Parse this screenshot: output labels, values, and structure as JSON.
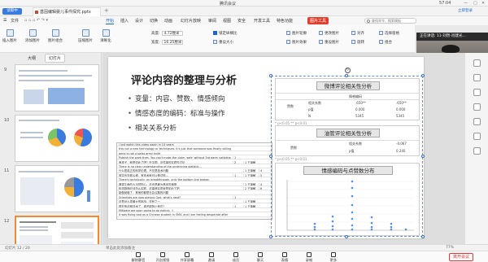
{
  "meeting": {
    "title": "腾讯会议",
    "clock": "57:04",
    "recording_badge": "读取中",
    "leave_label": "离开会议",
    "toolbar": [
      {
        "label": "解除静音",
        "icon": "mic-off-icon"
      },
      {
        "label": "开启视频",
        "icon": "camera-off-icon"
      },
      {
        "label": "共享屏幕",
        "icon": "share-screen-icon"
      },
      {
        "label": "邀请",
        "icon": "invite-icon"
      },
      {
        "label": "成员",
        "icon": "members-icon"
      },
      {
        "label": "聊天",
        "icon": "chat-icon"
      },
      {
        "label": "表情",
        "icon": "emoji-icon"
      },
      {
        "label": "录制",
        "icon": "record-icon"
      },
      {
        "label": "更多",
        "icon": "more-icon"
      }
    ],
    "speaker_label": "正在讲话: 11-刘然-肖建光...",
    "speaker_name": "11-刘然-肖建..."
  },
  "wps": {
    "doc_tab": "基因编辑婴儿事件探究.pptx",
    "sign_label": "立即登录",
    "menus": [
      "文件",
      "开始",
      "插入",
      "设计",
      "切换",
      "动画",
      "幻灯片放映",
      "审阅",
      "视图",
      "安全",
      "开发工具",
      "特色功能"
    ],
    "active_menu": "图片工具",
    "search_placeholder": "查找命令、搜索模板",
    "toolbar": {
      "big_buttons": [
        "插入图片",
        "添加图片",
        "图片组合",
        "压缩图片",
        "清晰化"
      ],
      "height_label": "高度:",
      "height_value": "4.72厘米",
      "width_label": "宽度:",
      "width_value": "16.25厘米",
      "lock_ratio": "锁定纵横比",
      "reset_size": "重设大小",
      "right_items": [
        "图片轮廓",
        "图片效果",
        "更改图片",
        "重设图片",
        "对齐",
        "旋转",
        "选择窗格",
        "组合"
      ]
    }
  },
  "left_panel": {
    "tab_outline": "大纲",
    "tab_slides": "幻灯片",
    "slide_numbers": [
      "9",
      "10",
      "11",
      "12"
    ]
  },
  "slide": {
    "title": "评论内容的整理与分析",
    "bullets": [
      "变量：内容、赞数、情感倾向",
      "情感态度的编码：标准与操作",
      "相关关系分析"
    ],
    "panel1": {
      "title": "微博评论相关性分析",
      "row_labels": [
        "",
        "赞数",
        ""
      ],
      "col_labels": [
        "",
        "情感编码"
      ],
      "cells": [
        "相关系数",
        ".650**",
        "p值",
        "0.000",
        "N",
        "5345"
      ],
      "note": "* p<0.05  ** p<0.01"
    },
    "panel2": {
      "title": "油管评论相关性分析",
      "cells": [
        "相关系数",
        "-0.067",
        "赞数",
        "p值",
        "0.240"
      ],
      "note": "* p<0.05  ** p<0.01"
    },
    "panel3": {
      "title": "情感编码与点赞数分布"
    },
    "table_note": "* p<0.05  ** p<0.01",
    "table_rows": [
      [
        "i just watch this video again in 10 years",
        "",
        "",
        ""
      ],
      [
        "this not a new technology or techniques. it's just that someone was finally willing to do it",
        "",
        "",
        ""
      ],
      [
        "gene is not a swiss army knife",
        "",
        "",
        ""
      ],
      [
        "Publish the work then. You can't make the claim 'safe' without 3rd party validation.",
        "1",
        "",
        ""
      ],
      [
        "养孩子，就是如此了吧？在中国，这件事的实质性讨论",
        "2",
        "1 王菊敏",
        ""
      ],
      [
        "There is no clear understanding of the underlying statistic...",
        "",
        "",
        ""
      ],
      [
        "什么是真正的科学伦理，不仅是技术问题",
        "",
        "1 王菊敏",
        "4"
      ],
      [
        "其实也没那么难：有技术就可以做试验…",
        "1",
        "1 王菊敏",
        "5"
      ],
      [
        "There's technically, on breakthrough, only the bottom line broken",
        "",
        "",
        ""
      ],
      [
        "尊重生命的人当然担心，这也是最为基本的道德",
        "",
        "1 王菊敏",
        "4"
      ],
      [
        "科学精神应该怎么实践，这事情实质就是如此了吧",
        "",
        "2 王菊敏",
        "6"
      ],
      [
        "能做就做了，其他的都是社会议题的问题",
        "",
        "",
        ""
      ],
      [
        "Scientists are now playing God, what's next?",
        "1",
        "",
        ""
      ],
      [
        "这是对人类最大的挑战，没有之一",
        "",
        "1 王菊敏",
        ""
      ],
      [
        "现在有这种技术了，谁还能阻止他们？",
        "1",
        "1 王菊敏",
        ""
      ],
      [
        "Mitigate are soon going to go extinct. ;)",
        "",
        "",
        ""
      ],
      [
        "it was fixing bad as a Chinese student in SMIC and I am feeling desperate after",
        "",
        "",
        ""
      ]
    ]
  },
  "status_bar": {
    "left": "幻灯片 12 / 20",
    "notes_placeholder": "单击此处添加备注",
    "zoom": "77%"
  },
  "colors": {
    "accent": "#1a66d8",
    "pic_tool": "#e23e2e",
    "leave": "#e53935",
    "selection": "#f08a36"
  }
}
